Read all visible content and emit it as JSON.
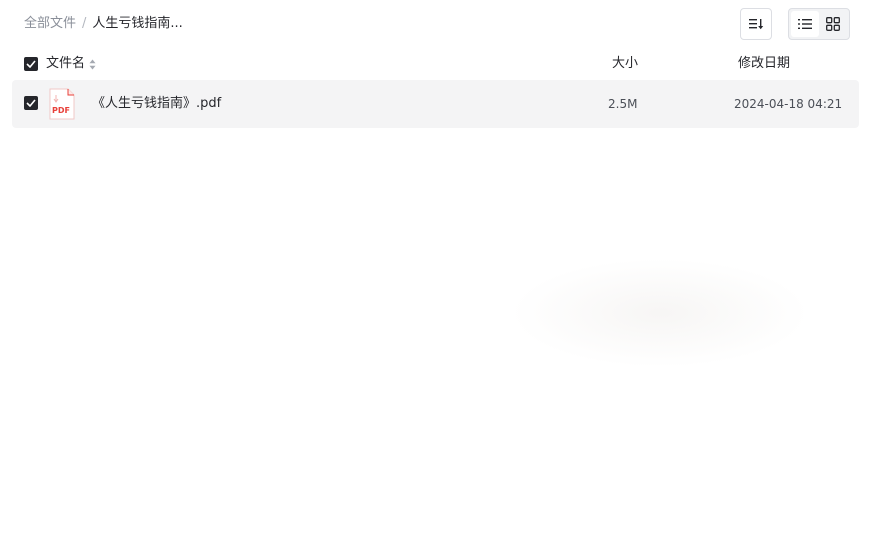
{
  "breadcrumb": {
    "root": "全部文件",
    "separator": "/",
    "current": "人生亏钱指南..."
  },
  "toolbar": {
    "sort_icon": "sort-lines-icon",
    "view_modes": [
      {
        "name": "list",
        "icon": "list-view-icon",
        "active": true
      },
      {
        "name": "grid",
        "icon": "grid-view-icon",
        "active": false
      }
    ]
  },
  "table": {
    "headers": {
      "name": "文件名",
      "size": "大小",
      "modified": "修改日期"
    },
    "select_all_checked": true,
    "rows": [
      {
        "checked": true,
        "icon": "pdf-file-icon",
        "icon_label": "PDF",
        "name": "《人生亏钱指南》.pdf",
        "size": "2.5M",
        "modified": "2024-04-18 04:21"
      }
    ]
  },
  "colors": {
    "checkbox": "#25262b",
    "row_hover": "#f4f4f5",
    "pdf_red": "#e8403a",
    "muted_text": "#8a8f99"
  }
}
